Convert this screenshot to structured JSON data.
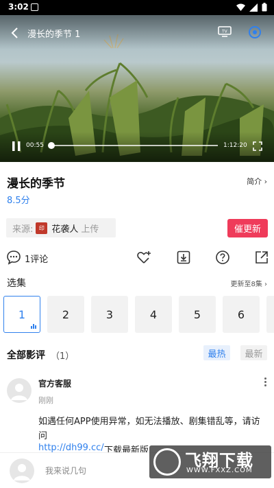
{
  "status_bar": {
    "time": "3:02"
  },
  "video": {
    "title": "漫长的季节 1",
    "elapsed": "00:55",
    "duration": "1:12:20",
    "progress_fraction": 0.008
  },
  "info": {
    "title": "漫长的季节",
    "score": "8.5分",
    "intro_label": "简介 ›",
    "source_label": "来源:",
    "uploader_name": "花袭人",
    "upload_suffix": "上传",
    "urge_button": "催更新"
  },
  "actions": {
    "comment_count": "1评论"
  },
  "episodes": {
    "label": "选集",
    "update_info": "更新至8集 ›",
    "items": [
      "1",
      "2",
      "3",
      "4",
      "5",
      "6"
    ],
    "active_index": 0
  },
  "reviews": {
    "title": "全部影评",
    "count": "（1）",
    "sort_hot": "最热",
    "sort_new": "最新",
    "items": [
      {
        "author": "官方客服",
        "time": "刚刚",
        "text": "如遇任何APP使用异常，如无法播放、剧集错乱等，请访问",
        "link": "http://dh99.cc/",
        "link_suffix": "下载最新版"
      }
    ]
  },
  "bottom_bar": {
    "placeholder": "我来说几句"
  },
  "watermark": {
    "text": "飞翔下载",
    "url": "WWW.FXXZ.COM"
  },
  "colors": {
    "accent": "#2f80ed",
    "urge": "#ef3b5a"
  }
}
